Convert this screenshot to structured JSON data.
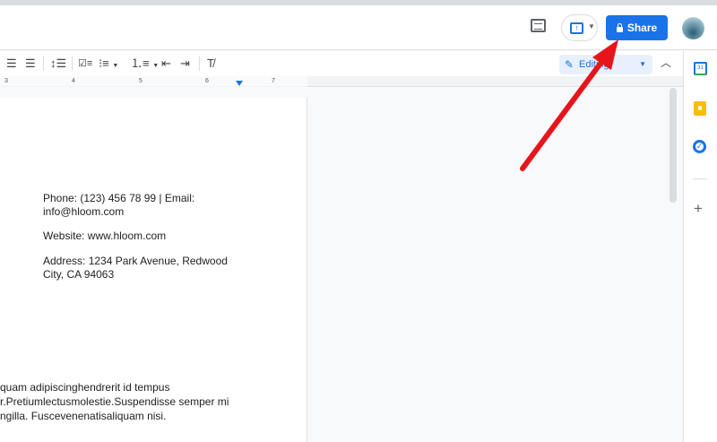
{
  "header": {
    "share_label": "Share",
    "present_icon_label": "↑"
  },
  "toolbar": {
    "mode_label": "Editing",
    "ruler_ticks": [
      "3",
      "4",
      "5",
      "6",
      "7"
    ]
  },
  "document": {
    "contact": [
      "Phone: (123) 456 78 99 | Email:",
      "info@hloom.com",
      "Website: www.hloom.com",
      "Address: 1234 Park Avenue, Redwood",
      "City, CA 94063"
    ],
    "body": [
      "quam adipiscinghendrerit id tempus",
      "r.Pretiumlectusmolestie.Suspendisse semper mi",
      "ngilla. Fuscevenenatisaliquam nisi."
    ]
  },
  "sidepanel": {
    "calendar_day": "31"
  },
  "colors": {
    "accent": "#1a73e8",
    "arrow": "#e8141b"
  }
}
